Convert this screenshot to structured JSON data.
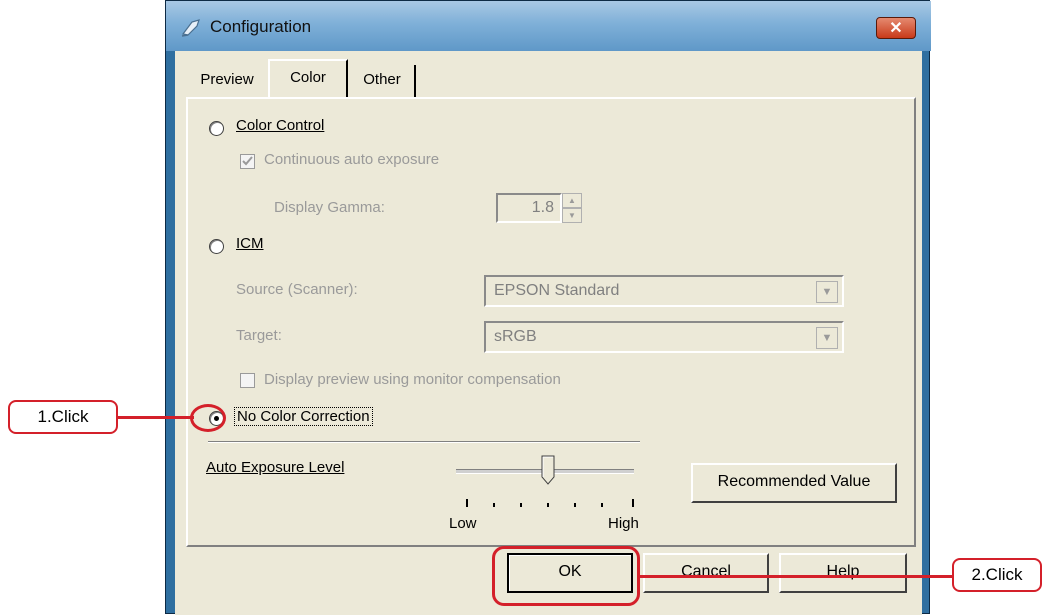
{
  "window": {
    "title": "Configuration",
    "close_label": "X"
  },
  "tabs": [
    {
      "label": "Preview"
    },
    {
      "label": "Color"
    },
    {
      "label": "Other"
    }
  ],
  "color_control": {
    "label": "Color Control",
    "continuous_label": "Continuous auto exposure",
    "gamma_label": "Display Gamma:",
    "gamma_value": "1.8"
  },
  "icm": {
    "label": "ICM",
    "source_label": "Source (Scanner):",
    "source_value": "EPSON Standard",
    "target_label": "Target:",
    "target_value": "sRGB",
    "preview_label": "Display preview using monitor compensation"
  },
  "no_color_correction": {
    "label": "No Color Correction"
  },
  "exposure": {
    "label": "Auto Exposure Level",
    "low_label": "Low",
    "high_label": "High",
    "recommended_label": "Recommended Value"
  },
  "buttons": {
    "ok": "OK",
    "cancel": "Cancel",
    "help": "Help"
  },
  "callouts": {
    "step1": "1.Click",
    "step2": "2.Click"
  },
  "colors": {
    "accent_red": "#d4202a"
  }
}
